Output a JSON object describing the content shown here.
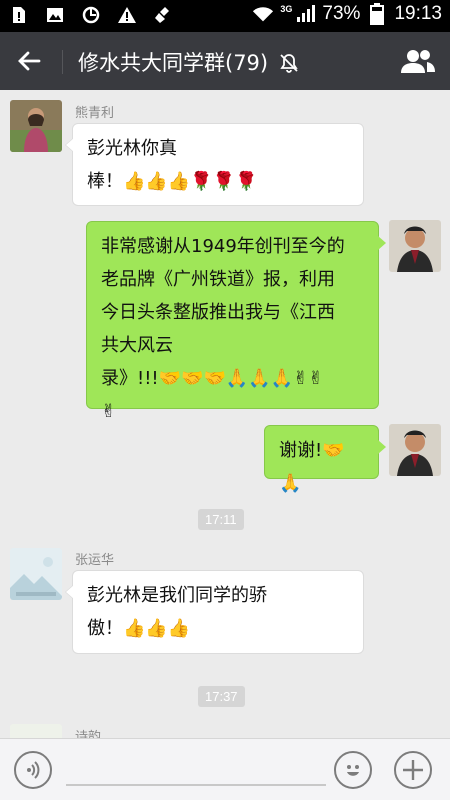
{
  "status_bar": {
    "network": "3G",
    "battery": "73%",
    "time": "19:13"
  },
  "header": {
    "title": "修水共大同学群(79)"
  },
  "messages": [
    {
      "sender": "熊青利",
      "line1": "彭光林你真",
      "line2": "棒！👍👍👍🌹🌹🌹"
    },
    {
      "line1": "非常感谢从1949年创刊至今的",
      "line2": "老品牌《广州铁道》报，利用",
      "line3": "今日头条整版推出我与《江西",
      "line4": "共大风云",
      "line5": "录》!!!🤝🤝🤝🙏🙏🙏✌✌",
      "line6": "✌"
    },
    {
      "text": "谢谢!🤝🙏"
    },
    {
      "sender": "张运华",
      "line1": "彭光林是我们同学的骄",
      "line2": "傲！👍👍👍"
    },
    {
      "sender": "诗韵"
    }
  ],
  "timestamps": [
    "17:11",
    "17:37"
  ]
}
